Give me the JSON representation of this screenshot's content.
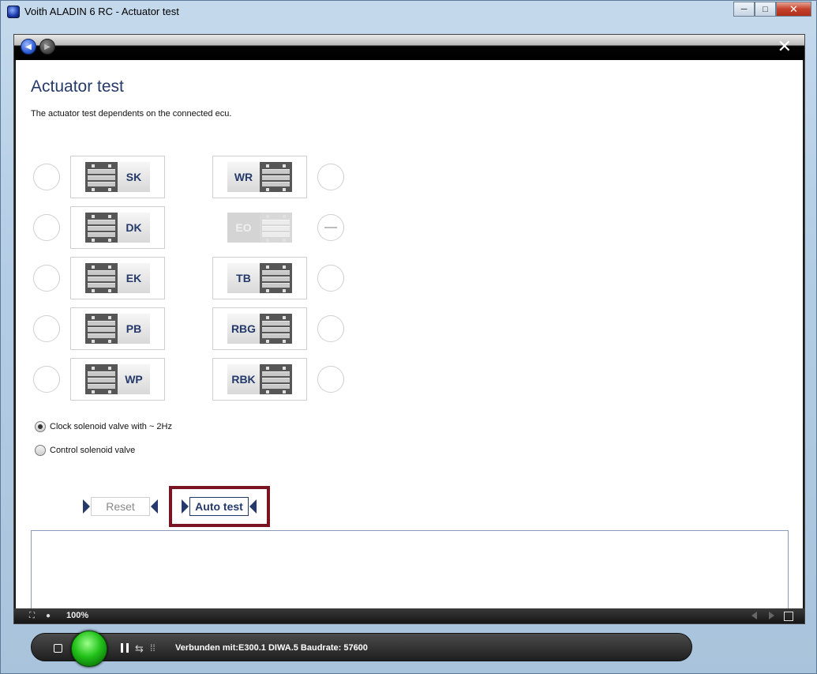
{
  "window": {
    "title": "Voith ALADIN 6 RC - Actuator test",
    "min_label": "─",
    "max_label": "□",
    "close_label": "✕"
  },
  "toolbar": {
    "back_label": "◀",
    "forward_label": "▶",
    "close_label": "✕"
  },
  "page": {
    "title": "Actuator test",
    "description": "The actuator test dependents on the connected ecu."
  },
  "actuators": {
    "left": [
      {
        "label": "SK",
        "enabled": true
      },
      {
        "label": "DK",
        "enabled": true
      },
      {
        "label": "EK",
        "enabled": true
      },
      {
        "label": "PB",
        "enabled": true
      },
      {
        "label": "WP",
        "enabled": true
      }
    ],
    "right": [
      {
        "label": "WR",
        "enabled": true
      },
      {
        "label": "EO",
        "enabled": false
      },
      {
        "label": "TB",
        "enabled": true
      },
      {
        "label": "RBG",
        "enabled": true
      },
      {
        "label": "RBK",
        "enabled": true
      }
    ]
  },
  "modes": {
    "clock": {
      "label": "Clock solenoid valve with ~ 2Hz",
      "checked": true
    },
    "control": {
      "label": "Control solenoid valve",
      "checked": false
    }
  },
  "commands": {
    "reset_label": "Reset",
    "auto_test_label": "Auto test"
  },
  "statusbar": {
    "zoom": "100%"
  },
  "player": {
    "connection_text": "Verbunden mit:E300.1  DIWA.5 Baudrate: 57600"
  },
  "colors": {
    "accent": "#253a6a",
    "highlight": "#7a1422",
    "go": "#22c21a"
  }
}
